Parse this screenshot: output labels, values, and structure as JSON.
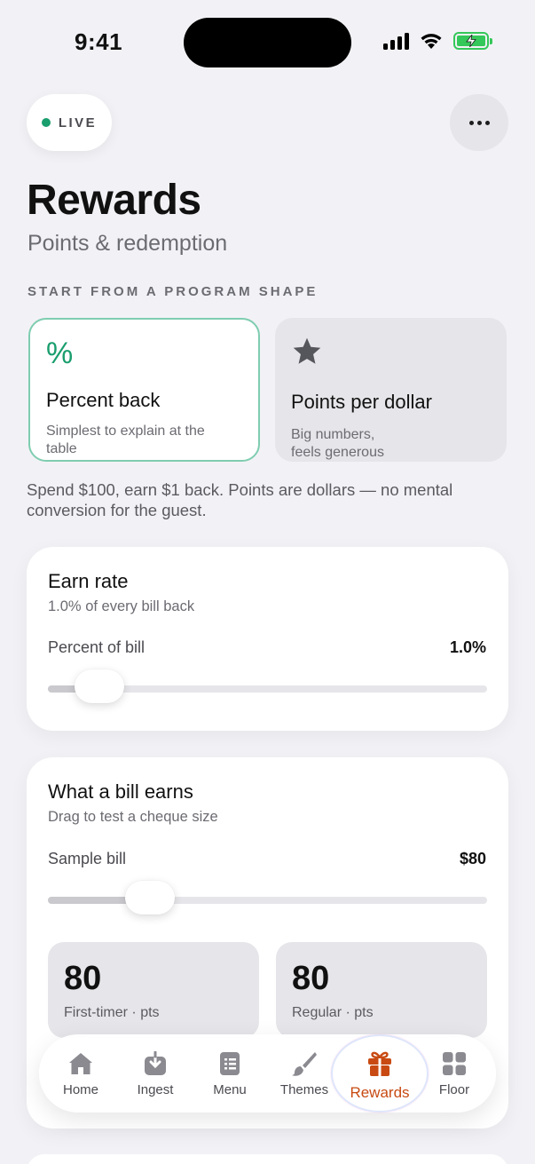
{
  "status_bar": {
    "time": "9:41"
  },
  "header": {
    "live_label": "LIVE",
    "title": "Rewards",
    "subtitle": "Points & redemption"
  },
  "program": {
    "section_label": "START FROM A PROGRAM SHAPE",
    "options": [
      {
        "icon": "percent-icon",
        "glyph": "%",
        "title": "Percent back",
        "desc": "Simplest to explain at the table",
        "selected": true
      },
      {
        "icon": "star-icon",
        "title": "Points per dollar",
        "desc": "Big numbers, feels generous",
        "selected": false
      }
    ],
    "explanation": "Spend $100, earn $1 back. Points are dollars — no mental conversion for the guest."
  },
  "earn_rate": {
    "title": "Earn rate",
    "subtitle": "1.0% of every bill back",
    "row_label": "Percent of bill",
    "row_value": "1.0%",
    "slider_fraction": 0.1
  },
  "bill_earns": {
    "title": "What a bill earns",
    "subtitle": "Drag to test a cheque size",
    "row_label": "Sample bill",
    "row_value": "$80",
    "slider_fraction": 0.22,
    "stats": [
      {
        "value": "80",
        "label": "First-timer · pts"
      },
      {
        "value": "80",
        "label": "Regular · pts"
      }
    ]
  },
  "tab_bar": {
    "tabs": [
      {
        "label": "Home",
        "icon": "home-icon"
      },
      {
        "label": "Ingest",
        "icon": "ingest-icon"
      },
      {
        "label": "Menu",
        "icon": "menu-icon"
      },
      {
        "label": "Themes",
        "icon": "brush-icon"
      },
      {
        "label": "Rewards",
        "icon": "gift-icon",
        "active": true
      },
      {
        "label": "Floor",
        "icon": "grid-icon"
      }
    ]
  },
  "colors": {
    "accent_green": "#1a9e6e",
    "active_tab": "#c84a12",
    "background": "#f2f2f6"
  }
}
